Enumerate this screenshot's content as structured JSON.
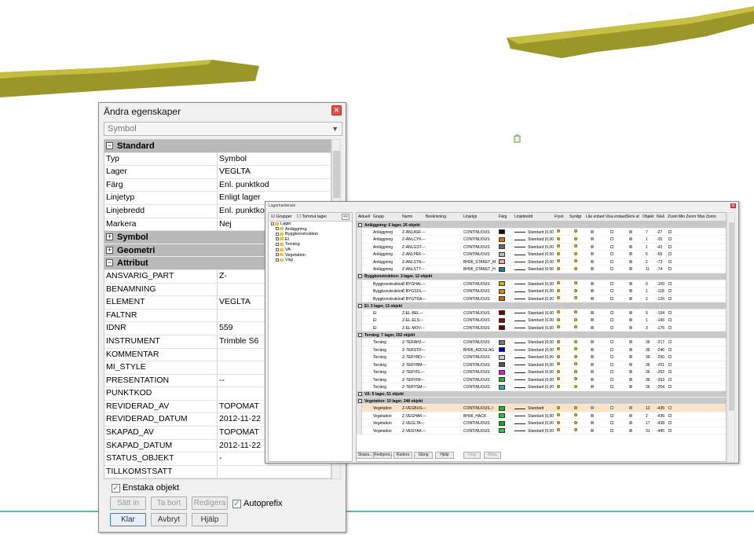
{
  "properties_dialog": {
    "title": "Ändra egenskaper",
    "object_type": "Symbol",
    "sections": {
      "standard": "Standard",
      "symbol": "Symbol",
      "geometri": "Geometri",
      "attribut": "Attribut"
    },
    "standard_rows": [
      {
        "k": "Typ",
        "v": "Symbol"
      },
      {
        "k": "Lager",
        "v": "VEGLTA"
      },
      {
        "k": "Färg",
        "v": "Enl. punktkod"
      },
      {
        "k": "Linjetyp",
        "v": "Enligt lager"
      },
      {
        "k": "Linjebredd",
        "v": "Enl. punktkod"
      },
      {
        "k": "Markera",
        "v": "Nej"
      }
    ],
    "attribute_rows": [
      {
        "k": "ANSVARIG_PART",
        "v": "Z-"
      },
      {
        "k": "BENAMNING",
        "v": ""
      },
      {
        "k": "ELEMENT",
        "v": "VEGLTA"
      },
      {
        "k": "FALTNR",
        "v": ""
      },
      {
        "k": "IDNR",
        "v": "559"
      },
      {
        "k": "INSTRUMENT",
        "v": "Trimble S6"
      },
      {
        "k": "KOMMENTAR",
        "v": ""
      },
      {
        "k": "MI_STYLE",
        "v": ""
      },
      {
        "k": "PRESENTATION",
        "v": "--"
      },
      {
        "k": "PUNKTKOD",
        "v": ""
      },
      {
        "k": "REVIDERAD_AV",
        "v": "TOPOMAT"
      },
      {
        "k": "REVIDERAD_DATUM",
        "v": "2012-11-22"
      },
      {
        "k": "SKAPAD_AV",
        "v": "TOPOMAT"
      },
      {
        "k": "SKAPAD_DATUM",
        "v": "2012-11-22"
      },
      {
        "k": "STATUS_OBJEKT",
        "v": "-"
      },
      {
        "k": "TILLKOMSTSATT",
        "v": ""
      }
    ],
    "enstaka_label": "Enstaka objekt",
    "enstaka_checked": true,
    "buttons": {
      "satt_in": "Sätt in",
      "ta_bort": "Ta bort",
      "redigera": "Redigera",
      "klar": "Klar",
      "avbryt": "Avbryt",
      "hjalp": "Hjälp"
    },
    "autoprefix_label": "Autoprefix",
    "autoprefix_checked": true
  },
  "layer_manager": {
    "title": "Lagerhanterare",
    "left_header": {
      "grupper": "Grupper",
      "tomma": "Tomma lager",
      "collapse": "<<"
    },
    "tree": [
      {
        "label": "Lager",
        "indent": 0
      },
      {
        "label": "Anläggning",
        "indent": 1
      },
      {
        "label": "Byggkonstruktion",
        "indent": 1
      },
      {
        "label": "El",
        "indent": 1
      },
      {
        "label": "Terräng",
        "indent": 1
      },
      {
        "label": "VA",
        "indent": 1
      },
      {
        "label": "Vegetation",
        "indent": 1
      },
      {
        "label": "Väg",
        "indent": 1
      }
    ],
    "columns": [
      "Aktuell",
      "Grupp",
      "Namn",
      "Beskrivning",
      "Linjetyp",
      "Färg",
      "Linjebredd",
      "Fryst",
      "Synligt",
      "Lås enbart",
      "Visa endast",
      "Skriv ut",
      "Objekt",
      "Nivå",
      "Zoom",
      "Min Zoom",
      "Max Zoom"
    ],
    "sections": [
      {
        "title": "Anläggning: 6 lager, 26 objekt",
        "rows": [
          {
            "grupp": "Anläggning",
            "namn": "Z-ANLASF---",
            "linjetyp": "CONTINUOUS",
            "farg": "#111111",
            "bredd": "Standard (0,00",
            "objekt": "7",
            "niva": "-27"
          },
          {
            "grupp": "Anläggning",
            "namn": "Z-ANLCYK---",
            "linjetyp": "CONTINUOUS",
            "farg": "#e46c0a",
            "bredd": "Standard (0,00",
            "objekt": "1",
            "niva": "-35"
          },
          {
            "grupp": "Anläggning",
            "namn": "Z-ANLGST---",
            "linjetyp": "CONTINUOUS",
            "farg": "#666666",
            "bredd": "Standard (0,00",
            "objekt": "1",
            "niva": "-42"
          },
          {
            "grupp": "Anläggning",
            "namn": "Z-ANLPEK---",
            "linjetyp": "CONTINUOUS",
            "farg": "#bbbbbb",
            "bredd": "Standard (0,00",
            "objekt": "6",
            "niva": "-55"
          },
          {
            "grupp": "Anläggning",
            "namn": "Z-ANLSTN---",
            "linjetyp": "BH96_STAKET_M",
            "farg": "#f2b08a",
            "bredd": "Standard (0,00",
            "objekt": "2",
            "niva": "-73"
          },
          {
            "grupp": "Anläggning",
            "namn": "Z-ANLSTT---",
            "linjetyp": "BH96_STAKET_H",
            "farg": "#1a7f8a",
            "bredd": "Standard (0,00",
            "objekt": "11",
            "niva": "-74"
          }
        ]
      },
      {
        "title": "Byggkonstruktion: 3 lager, 12 objekt",
        "rows": [
          {
            "grupp": "Byggkonstruktion",
            "namn": "Z-BYGHAL---",
            "linjetyp": "CONTINUOUS",
            "farg": "#d4b000",
            "bredd": "Standard (0,00",
            "objekt": "9",
            "niva": "-100"
          },
          {
            "grupp": "Byggkonstruktion",
            "namn": "Z-BYGSOL---",
            "linjetyp": "CONTINUOUS",
            "farg": "#d48a00",
            "bredd": "Standard (0,00",
            "objekt": "1",
            "niva": "-118"
          },
          {
            "grupp": "Byggkonstruktion",
            "namn": "Z-BYGTRA---",
            "linjetyp": "CONTINUOUS",
            "farg": "#c86414",
            "bredd": "Standard (0,00",
            "objekt": "2",
            "niva": "-126"
          }
        ]
      },
      {
        "title": "El: 3 lager, 13 objekt",
        "rows": [
          {
            "grupp": "El",
            "namn": "Z-EL-BEL---",
            "linjetyp": "CONTINUOUS",
            "farg": "#7a0000",
            "bredd": "Standard (0,00",
            "objekt": "9",
            "niva": "-154"
          },
          {
            "grupp": "El",
            "namn": "Z-EL-ELS---",
            "linjetyp": "CONTINUOUS",
            "farg": "#8a0a0a",
            "bredd": "Standard (0,00",
            "objekt": "1",
            "niva": "-166"
          },
          {
            "grupp": "El",
            "namn": "Z-EL-MOV---",
            "linjetyp": "CONTINUOUS",
            "farg": "#6a0000",
            "bredd": "Standard (0,00",
            "objekt": "3",
            "niva": "-176"
          }
        ]
      },
      {
        "title": "Terräng: 7 lager, 252 objekt",
        "rows": [
          {
            "grupp": "Terräng",
            "namn": "Z-TERAHZ---",
            "linjetyp": "CONTINUOUS",
            "farg": "#777777",
            "bredd": "Standard (0,00",
            "objekt": "36",
            "niva": "-217"
          },
          {
            "grupp": "Terräng",
            "namn": "Z-TERSTR---",
            "linjetyp": "BH96_ADDSLAG",
            "farg": "#0000cc",
            "bredd": "Standard (0,00",
            "objekt": "36",
            "niva": "-246"
          },
          {
            "grupp": "Terräng",
            "namn": "Z-TERYBD---",
            "linjetyp": "CONTINUOUS",
            "farg": "#cccccc",
            "bredd": "Standard (0,00",
            "objekt": "36",
            "niva": "-250"
          },
          {
            "grupp": "Terräng",
            "namn": "Z-TERYBM---",
            "linjetyp": "CONTINUOUS",
            "farg": "#555555",
            "bredd": "Standard (0,00",
            "objekt": "36",
            "niva": "-251"
          },
          {
            "grupp": "Terräng",
            "namn": "Z-TERYFL---",
            "linjetyp": "CONTINUOUS",
            "farg": "#e020e0",
            "bredd": "Standard (0,00",
            "objekt": "36",
            "niva": "-252"
          },
          {
            "grupp": "Terräng",
            "namn": "Z-TERYIM---",
            "linjetyp": "CONTINUOUS",
            "farg": "#28b028",
            "bredd": "Standard (0,00",
            "objekt": "36",
            "niva": "-253"
          },
          {
            "grupp": "Terräng",
            "namn": "Z-TERYSM---",
            "linjetyp": "CONTINUOUS",
            "farg": "#20b0b0",
            "bredd": "Standard (0,00",
            "objekt": "36",
            "niva": "-254"
          }
        ]
      },
      {
        "title": "VA: 5 lager, 51 objekt",
        "rows": []
      },
      {
        "title": "Vegetation: 10 lager, 248 objekt",
        "rows": [
          {
            "grupp": "Vegetation",
            "namn": "Z-VEGBUS---",
            "linjetyp": "CONTINUOUS, I",
            "farg": "#22bb22",
            "bredd": "Standard",
            "objekt": "12",
            "niva": "-435",
            "selected": true
          },
          {
            "grupp": "Vegetation",
            "namn": "Z-VEGHAK---",
            "linjetyp": "BH96_HACK",
            "farg": "#22cc22",
            "bredd": "Standard (0,00",
            "objekt": "2",
            "niva": "-436"
          },
          {
            "grupp": "Vegetation",
            "namn": "Z-VEGLTA---",
            "linjetyp": "CONTINUOUS",
            "farg": "#11aa11",
            "bredd": "Standard (0,00",
            "objekt": "17",
            "niva": "-438"
          },
          {
            "grupp": "Vegetation",
            "namn": "Z-VEGYAK---",
            "linjetyp": "CONTINUOUS",
            "farg": "#33cc33",
            "bredd": "Standard (0,00",
            "objekt": "31",
            "niva": "-445"
          }
        ]
      }
    ],
    "buttons": [
      "Skapa...",
      "Redigera...",
      "Radera",
      "Stäng",
      "Hjälp"
    ],
    "buttons_disabled": [
      "Färg",
      "Mata"
    ]
  },
  "colors": {
    "terrain_fill": "#9b9a2a",
    "terrain_light": "#c9c24a",
    "accent_line": "#5fb3b3"
  }
}
